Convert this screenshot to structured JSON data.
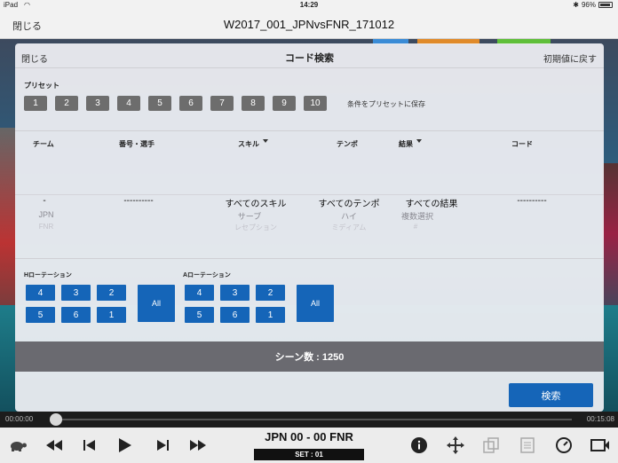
{
  "status_bar": {
    "device": "iPad",
    "time": "14:29",
    "battery": "96%"
  },
  "navbar": {
    "close_label": "閉じる",
    "title": "W2017_001_JPNvsFNR_171012"
  },
  "modal": {
    "close_label": "閉じる",
    "title": "コード検索",
    "reset_label": "初期値に戻す",
    "preset_label": "プリセット",
    "presets": [
      "1",
      "2",
      "3",
      "4",
      "5",
      "6",
      "7",
      "8",
      "9",
      "10"
    ],
    "save_preset_label": "条件をプリセットに保存",
    "filter_headers": {
      "team": "チーム",
      "player": "番号・選手",
      "skill": "スキル",
      "tempo": "テンポ",
      "result": "結果",
      "code": "コード"
    },
    "wheel_selected": {
      "team": "-",
      "player": "----------",
      "skill": "すべてのスキル",
      "tempo": "すべてのテンポ",
      "result": "すべての結果",
      "code": "----------"
    },
    "wheel_next": {
      "team": "JPN",
      "skill": "サーブ",
      "tempo": "ハイ",
      "result": "複数選択"
    },
    "wheel_next2": {
      "team": "FNR",
      "skill": "レセプション",
      "tempo": "ミディアム",
      "result": "#"
    },
    "h_rotation": {
      "label": "Hローテーション",
      "buttons": [
        "4",
        "3",
        "2",
        "5",
        "6",
        "1"
      ],
      "all_label": "All"
    },
    "a_rotation": {
      "label": "Aローテーション",
      "buttons": [
        "4",
        "3",
        "2",
        "5",
        "6",
        "1"
      ],
      "all_label": "All"
    },
    "scene_count": "シーン数 : 1250",
    "search_label": "検索"
  },
  "timebar": {
    "start": "00:00:00",
    "end": "00:15:08"
  },
  "controls": {
    "score": "JPN 00 - 00 FNR",
    "set": "SET : 01"
  },
  "icons": [
    "turtle-icon",
    "rewind-icon",
    "skip-back-icon",
    "play-icon",
    "skip-forward-icon",
    "fast-forward-icon",
    "info-icon",
    "move-icon",
    "copy-icon",
    "document-icon",
    "timer-icon",
    "video-icon"
  ]
}
